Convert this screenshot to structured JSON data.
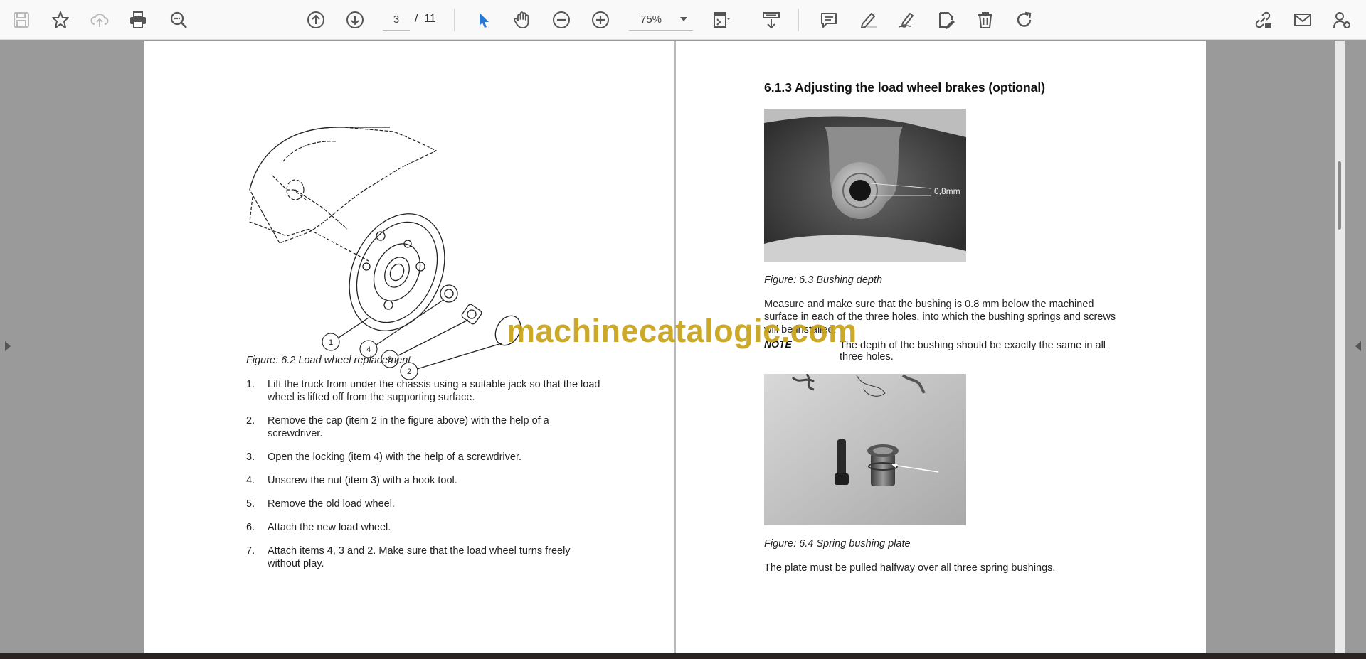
{
  "toolbar": {
    "page_current": "3",
    "page_separator": "/",
    "page_total": "11",
    "zoom": "75%",
    "icons": [
      "save-icon",
      "bookmark-star-icon",
      "upload-cloud-icon",
      "print-icon",
      "find-zoom-icon",
      "page-up-icon",
      "page-down-icon",
      "select-cursor-icon",
      "hand-pan-icon",
      "zoom-out-icon",
      "zoom-in-icon",
      "fit-page-icon",
      "scroll-mode-icon",
      "comment-icon",
      "highlight-pen-icon",
      "sign-pen-icon",
      "edit-icon",
      "delete-icon",
      "rotate-icon",
      "share-link-icon",
      "email-icon",
      "add-user-icon"
    ]
  },
  "left_page": {
    "figure_callouts": [
      "1",
      "4",
      "3",
      "2"
    ],
    "figure_caption": "Figure: 6.2 Load wheel replacement",
    "steps": [
      {
        "num": "1.",
        "text": "Lift the truck from under the chassis using a suitable jack so that the load wheel is lifted off from the supporting surface."
      },
      {
        "num": "2.",
        "text": "Remove the cap (item 2 in the figure above) with the help of a screwdriver."
      },
      {
        "num": "3.",
        "text": "Open the locking (item 4) with the help of a screwdriver."
      },
      {
        "num": "4.",
        "text": "Unscrew the nut (item 3) with a hook tool."
      },
      {
        "num": "5.",
        "text": "Remove the old load wheel."
      },
      {
        "num": "6.",
        "text": "Attach the new load wheel."
      },
      {
        "num": "7.",
        "text": "Attach items 4, 3 and 2. Make sure that the load wheel turns freely without play."
      }
    ]
  },
  "right_page": {
    "heading": "6.1.3 Adjusting the load wheel brakes (optional)",
    "photo1_label": "0,8mm",
    "figure1_caption": "Figure: 6.3 Bushing depth",
    "paragraph1": "Measure and make sure that the bushing is 0.8 mm below the machined surface in each of the three holes, into which the bushing springs and screws will be installed.",
    "note_label": "NOTE",
    "note_text": "The depth of the bushing should be exactly the same in all three holes.",
    "figure2_caption": "Figure: 6.4 Spring bushing plate",
    "paragraph2": "The plate must be pulled halfway over all three spring bushings."
  },
  "watermark": "machinecatalogic.com"
}
